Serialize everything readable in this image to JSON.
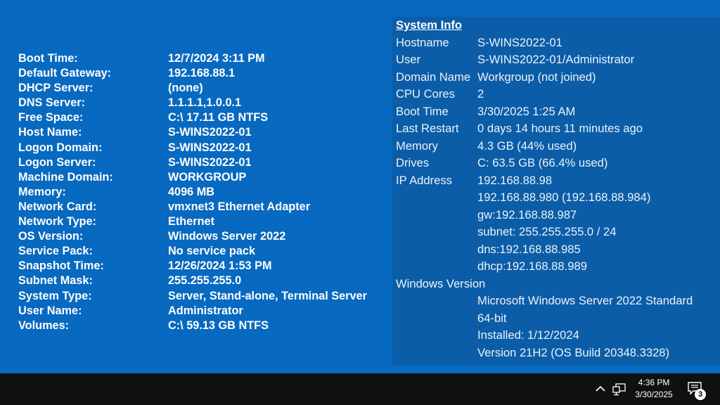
{
  "bginfo": [
    {
      "label": "Boot Time:",
      "value": "12/7/2024 3:11 PM"
    },
    {
      "label": "Default Gateway:",
      "value": "192.168.88.1"
    },
    {
      "label": "DHCP Server:",
      "value": "(none)"
    },
    {
      "label": "DNS Server:",
      "value": "1.1.1.1,1.0.0.1"
    },
    {
      "label": "Free Space:",
      "value": "C:\\ 17.11 GB NTFS"
    },
    {
      "label": "Host Name:",
      "value": "S-WINS2022-01"
    },
    {
      "label": "Logon Domain:",
      "value": "S-WINS2022-01"
    },
    {
      "label": "Logon Server:",
      "value": "S-WINS2022-01"
    },
    {
      "label": "Machine Domain:",
      "value": "WORKGROUP"
    },
    {
      "label": "Memory:",
      "value": "4096 MB"
    },
    {
      "label": "Network Card:",
      "value": "vmxnet3 Ethernet Adapter"
    },
    {
      "label": "Network Type:",
      "value": "Ethernet"
    },
    {
      "label": "OS Version:",
      "value": "Windows Server 2022"
    },
    {
      "label": "Service Pack:",
      "value": "No service pack"
    },
    {
      "label": "Snapshot Time:",
      "value": "12/26/2024 1:53 PM"
    },
    {
      "label": "Subnet Mask:",
      "value": "255.255.255.0"
    },
    {
      "label": "System Type:",
      "value": "Server, Stand-alone, Terminal Server"
    },
    {
      "label": "User Name:",
      "value": "Administrator"
    },
    {
      "label": "Volumes:",
      "value": "C:\\ 59.13 GB NTFS"
    }
  ],
  "sysinfo": {
    "title": "System Info",
    "rows": [
      {
        "label": "Hostname",
        "value": "S-WINS2022-01"
      },
      {
        "label": "User",
        "value": "S-WINS2022-01/Administrator"
      },
      {
        "label": "Domain Name",
        "value": "Workgroup (not joined)"
      },
      {
        "label": "CPU Cores",
        "value": "2"
      },
      {
        "label": "Boot Time",
        "value": "3/30/2025 1:25 AM"
      },
      {
        "label": "Last Restart",
        "value": "0 days 14 hours 11 minutes ago"
      },
      {
        "label": "Memory",
        "value": "4.3 GB (44% used)"
      },
      {
        "label": "Drives",
        "value": "C: 63.5 GB (66.4% used)"
      },
      {
        "label": "IP Address",
        "value": "192.168.88.98"
      }
    ],
    "ip_details": [
      "192.168.88.980 (192.168.88.984)",
      "gw:192.168.88.987",
      "subnet: 255.255.255.0 / 24",
      "dns:192.168.88.985",
      "dhcp:192.168.88.989"
    ],
    "windows_label": "Windows Version",
    "windows_details": [
      "Microsoft Windows Server 2022 Standard",
      "64-bit",
      "Installed: 1/12/2024",
      "Version 21H2 (OS Build 20348.3328)"
    ]
  },
  "taskbar": {
    "time": "4:36 PM",
    "date": "3/30/2025",
    "notification_count": "3",
    "icons": [
      "chevron-up-icon",
      "network-icon",
      "notification-icon"
    ]
  }
}
